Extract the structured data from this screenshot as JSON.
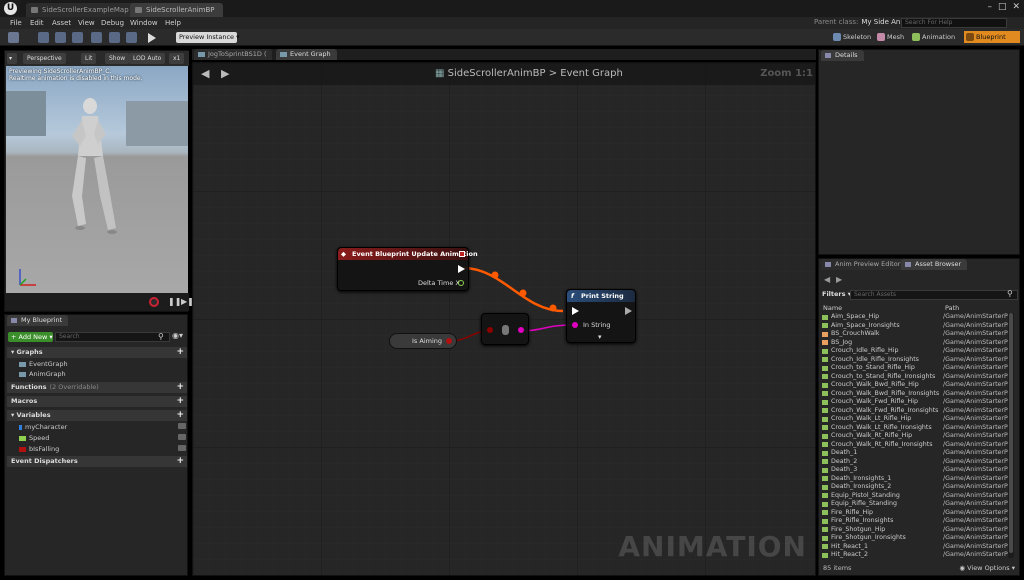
{
  "window": {
    "tabs": [
      {
        "label": "SideScrollerExampleMap"
      },
      {
        "label": "SideScrollerAnimBP"
      }
    ],
    "parent_class_label": "Parent class:",
    "parent_class_value": "My Side Anim",
    "help_search_placeholder": "Search For Help"
  },
  "menu": [
    "File",
    "Edit",
    "Asset",
    "View",
    "Debug",
    "Window",
    "Help"
  ],
  "toolbar": {
    "preview_instance": "Preview Instance",
    "modes": [
      "Skeleton",
      "Mesh",
      "Animation",
      "Blueprint"
    ],
    "accent": "#e08a1f"
  },
  "viewport": {
    "perspective": "Perspective",
    "lit": "Lit",
    "show": "Show",
    "lod": "LOD Auto",
    "speed": "x1",
    "message_line1": "Previewing SideScrollerAnimBP_C.",
    "message_line2": "Realtime animation is disabled in this mode."
  },
  "my_blueprint": {
    "tab": "My Blueprint",
    "add_new": "Add New",
    "search_placeholder": "Search",
    "graphs_header": "Graphs",
    "graphs": [
      "EventGraph",
      "AnimGraph"
    ],
    "functions_header": "Functions",
    "functions_hint": "(2 Overridable)",
    "macros_header": "Macros",
    "variables_header": "Variables",
    "variables": [
      {
        "name": "myCharacter",
        "color": "#2f7fe0"
      },
      {
        "name": "Speed",
        "color": "#8fd14f"
      },
      {
        "name": "bIsFalling",
        "color": "#b01010"
      }
    ],
    "dispatchers_header": "Event Dispatchers"
  },
  "graph": {
    "tabs": [
      "JogToSprintBS1D (",
      "Event Graph"
    ],
    "breadcrumb_asset": "SideScrollerAnimBP",
    "breadcrumb_sep": ">",
    "breadcrumb_graph": "Event Graph",
    "zoom": "Zoom 1:1",
    "watermark": "ANIMATION",
    "event_node": {
      "title": "Event Blueprint Update Animation",
      "pin": "Delta Time X",
      "color": "#8a1c1c"
    },
    "print_node": {
      "title": "Print String",
      "pin": "In String",
      "color": "#2b4d7a"
    },
    "var_node": {
      "label": "Is Aiming"
    },
    "wire_exec_color": "#ff5a00",
    "wire_string_color": "#e000c0",
    "wire_bool_color": "#8c0000"
  },
  "details": {
    "tab": "Details"
  },
  "asset_browser": {
    "tabs": [
      "Anim Preview Editor",
      "Asset Browser"
    ],
    "filters": "Filters",
    "search_placeholder": "Search Assets",
    "col_name": "Name",
    "col_path": "Path",
    "items": [
      {
        "name": "Aim_Space_Hip",
        "path": "/Game/AnimStarterPa",
        "color": "#8dbf5a"
      },
      {
        "name": "Aim_Space_Ironsights",
        "path": "/Game/AnimStarterPa",
        "color": "#8dbf5a"
      },
      {
        "name": "BS_CrouchWalk",
        "path": "/Game/AnimStarterPa",
        "color": "#e8a060"
      },
      {
        "name": "BS_Jog",
        "path": "/Game/AnimStarterPa",
        "color": "#e8a060"
      },
      {
        "name": "Crouch_Idle_Rifle_Hip",
        "path": "/Game/AnimStarterPa",
        "color": "#8dbf5a"
      },
      {
        "name": "Crouch_Idle_Rifle_Ironsights",
        "path": "/Game/AnimStarterPa",
        "color": "#8dbf5a"
      },
      {
        "name": "Crouch_to_Stand_Rifle_Hip",
        "path": "/Game/AnimStarterPa",
        "color": "#8dbf5a"
      },
      {
        "name": "Crouch_to_Stand_Rifle_Ironsights",
        "path": "/Game/AnimStarterPa",
        "color": "#8dbf5a"
      },
      {
        "name": "Crouch_Walk_Bwd_Rifle_Hip",
        "path": "/Game/AnimStarterPa",
        "color": "#8dbf5a"
      },
      {
        "name": "Crouch_Walk_Bwd_Rifle_Ironsights",
        "path": "/Game/AnimStarterPa",
        "color": "#8dbf5a"
      },
      {
        "name": "Crouch_Walk_Fwd_Rifle_Hip",
        "path": "/Game/AnimStarterPa",
        "color": "#8dbf5a"
      },
      {
        "name": "Crouch_Walk_Fwd_Rifle_Ironsights",
        "path": "/Game/AnimStarterPa",
        "color": "#8dbf5a"
      },
      {
        "name": "Crouch_Walk_Lt_Rifle_Hip",
        "path": "/Game/AnimStarterPa",
        "color": "#8dbf5a"
      },
      {
        "name": "Crouch_Walk_Lt_Rifle_Ironsights",
        "path": "/Game/AnimStarterPa",
        "color": "#8dbf5a"
      },
      {
        "name": "Crouch_Walk_Rt_Rifle_Hip",
        "path": "/Game/AnimStarterPa",
        "color": "#8dbf5a"
      },
      {
        "name": "Crouch_Walk_Rt_Rifle_Ironsights",
        "path": "/Game/AnimStarterPa",
        "color": "#8dbf5a"
      },
      {
        "name": "Death_1",
        "path": "/Game/AnimStarterPa",
        "color": "#8dbf5a"
      },
      {
        "name": "Death_2",
        "path": "/Game/AnimStarterPa",
        "color": "#8dbf5a"
      },
      {
        "name": "Death_3",
        "path": "/Game/AnimStarterPa",
        "color": "#8dbf5a"
      },
      {
        "name": "Death_Ironsights_1",
        "path": "/Game/AnimStarterPa",
        "color": "#8dbf5a"
      },
      {
        "name": "Death_Ironsights_2",
        "path": "/Game/AnimStarterPa",
        "color": "#8dbf5a"
      },
      {
        "name": "Equip_Pistol_Standing",
        "path": "/Game/AnimStarterPa",
        "color": "#8dbf5a"
      },
      {
        "name": "Equip_Rifle_Standing",
        "path": "/Game/AnimStarterPa",
        "color": "#8dbf5a"
      },
      {
        "name": "Fire_Rifle_Hip",
        "path": "/Game/AnimStarterPa",
        "color": "#8dbf5a"
      },
      {
        "name": "Fire_Rifle_Ironsights",
        "path": "/Game/AnimStarterPa",
        "color": "#8dbf5a"
      },
      {
        "name": "Fire_Shotgun_Hip",
        "path": "/Game/AnimStarterPa",
        "color": "#8dbf5a"
      },
      {
        "name": "Fire_Shotgun_Ironsights",
        "path": "/Game/AnimStarterPa",
        "color": "#8dbf5a"
      },
      {
        "name": "Hit_React_1",
        "path": "/Game/AnimStarterPa",
        "color": "#8dbf5a"
      },
      {
        "name": "Hit_React_2",
        "path": "/Game/AnimStarterPa",
        "color": "#8dbf5a"
      }
    ],
    "count": "85 items",
    "view_options": "View Options"
  }
}
